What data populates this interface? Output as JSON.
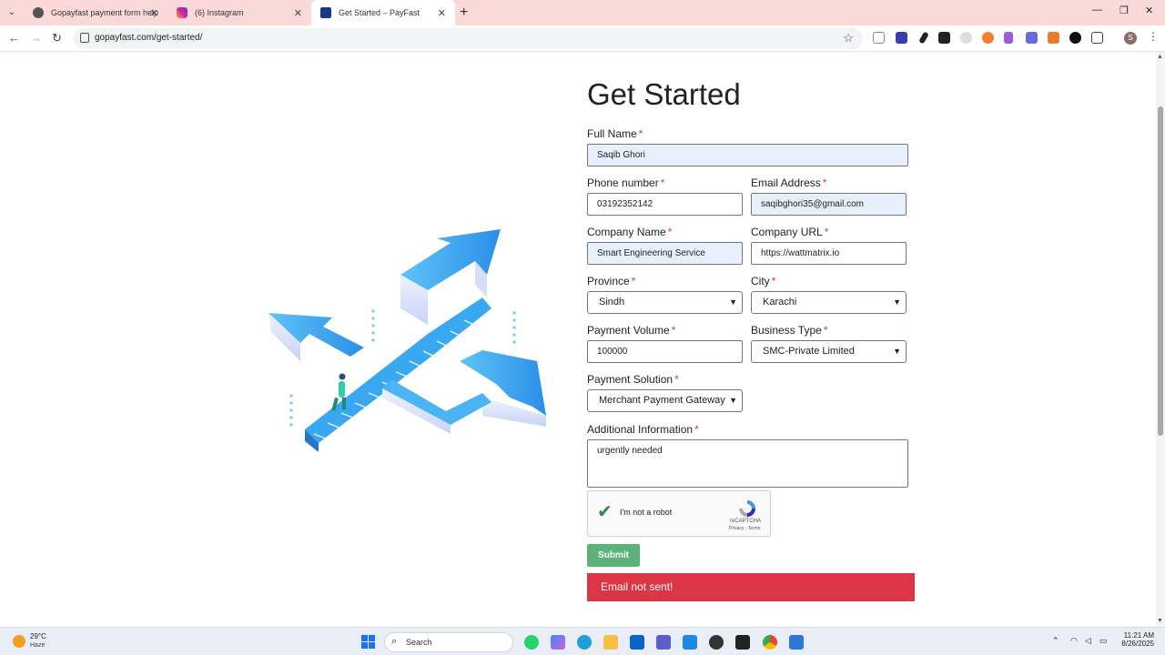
{
  "browser": {
    "tabs": [
      {
        "title": "Gopayfast payment form help",
        "active": false
      },
      {
        "title": "(6) Instagram",
        "active": false
      },
      {
        "title": "Get Started – PayFast",
        "active": true
      }
    ],
    "url": "gopayfast.com/get-started/",
    "profile_initial": "S"
  },
  "form": {
    "title": "Get Started",
    "full_name": {
      "label": "Full Name",
      "value": "Saqib Ghori"
    },
    "phone": {
      "label": "Phone number",
      "value": "03192352142"
    },
    "email": {
      "label": "Email Address",
      "value": "saqibghori35@gmail.com"
    },
    "company_name": {
      "label": "Company Name",
      "value": "Smart Engineering Service"
    },
    "company_url": {
      "label": "Company URL",
      "value": "https://wattmatrix.io"
    },
    "province": {
      "label": "Province",
      "value": "Sindh"
    },
    "city": {
      "label": "City",
      "value": "Karachi"
    },
    "payment_volume": {
      "label": "Payment Volume",
      "value": "100000"
    },
    "business_type": {
      "label": "Business Type",
      "value": "SMC-Private Limited"
    },
    "payment_solution": {
      "label": "Payment Solution",
      "value": "Merchant Payment Gateway"
    },
    "additional_info": {
      "label": "Additional Information",
      "value": "urgently needed"
    },
    "required_mark": "*",
    "captcha": {
      "label": "I'm not a robot",
      "brand": "reCAPTCHA",
      "links": "Privacy - Terms"
    },
    "submit_label": "Submit",
    "alert_text": "Email not sent!"
  },
  "taskbar": {
    "temperature": "29°C",
    "condition": "Haze",
    "search_placeholder": "Search",
    "time": "11:21 AM",
    "date": "8/26/2025"
  },
  "colors": {
    "tabbar": "#fcd9d9",
    "submit": "#5cb377",
    "alert": "#dc3545",
    "autofill": "#e8f0fe",
    "arrows": "#3aa8f0"
  }
}
